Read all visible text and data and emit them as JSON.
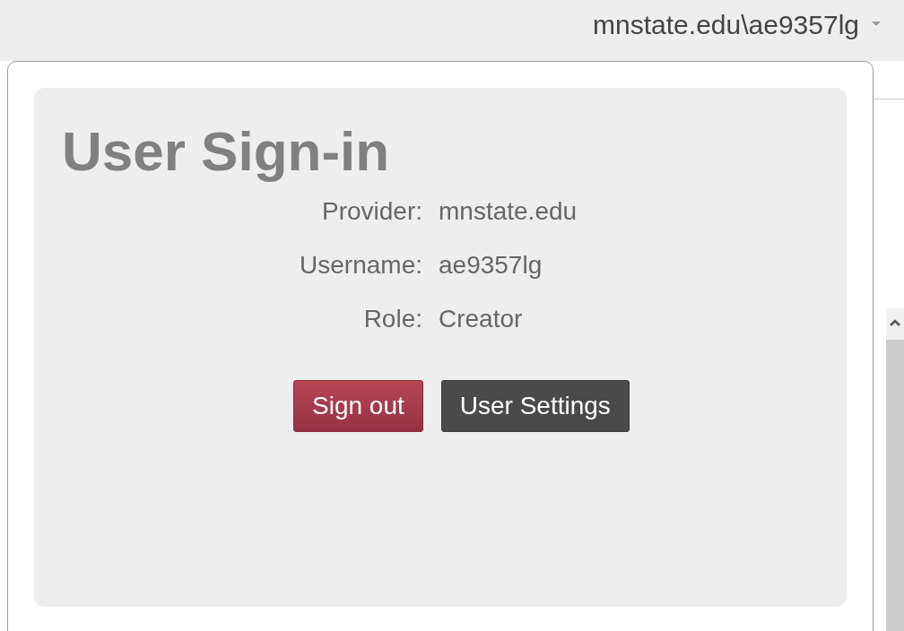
{
  "header": {
    "account": "mnstate.edu\\ae9357lg"
  },
  "popup": {
    "title": "User Sign-in",
    "fields": [
      {
        "label": "Provider:",
        "value": "mnstate.edu"
      },
      {
        "label": "Username:",
        "value": "ae9357lg"
      },
      {
        "label": "Role:",
        "value": "Creator"
      }
    ],
    "buttons": [
      {
        "label": "Sign out",
        "kind": "danger"
      },
      {
        "label": "User Settings",
        "kind": "dark"
      }
    ]
  }
}
